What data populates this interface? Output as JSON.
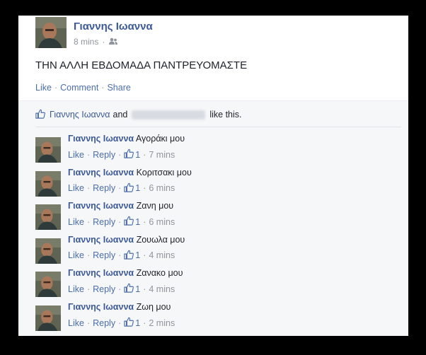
{
  "post": {
    "author": "Γιαννης Ιωαννα",
    "time": "8 mins",
    "separator": "·",
    "text": "ΤΗΝ ΑΛΛΗ ΕΒΔΟΜΑΔΑ ΠΑΝΤΡΕΥΟΜΑΣΤΕ",
    "actions": {
      "like": "Like",
      "comment": "Comment",
      "share": "Share"
    }
  },
  "likes": {
    "name": "Γιαννης Ιωαννα",
    "and": "and",
    "suffix": "like this."
  },
  "comments": [
    {
      "author": "Γιαννης Ιωαννα",
      "text": "Αγοράκι μου",
      "like": "Like",
      "reply": "Reply",
      "count": "1",
      "time": "7 mins"
    },
    {
      "author": "Γιαννης Ιωαννα",
      "text": "Κοριτσακι μου",
      "like": "Like",
      "reply": "Reply",
      "count": "1",
      "time": "6 mins"
    },
    {
      "author": "Γιαννης Ιωαννα",
      "text": "Ζανη μου",
      "like": "Like",
      "reply": "Reply",
      "count": "1",
      "time": "6 mins"
    },
    {
      "author": "Γιαννης Ιωαννα",
      "text": "Ζουωλα μου",
      "like": "Like",
      "reply": "Reply",
      "count": "1",
      "time": "4 mins"
    },
    {
      "author": "Γιαννης Ιωαννα",
      "text": "Ζανακο μου",
      "like": "Like",
      "reply": "Reply",
      "count": "1",
      "time": "4 mins"
    },
    {
      "author": "Γιαννης Ιωαννα",
      "text": "Ζωη μου",
      "like": "Like",
      "reply": "Reply",
      "count": "1",
      "time": "2 mins"
    }
  ],
  "colors": {
    "link": "#3b5998",
    "muted": "#90949c",
    "background": "#000000"
  },
  "icons": {
    "audience": "friends-icon",
    "like": "thumbs-up-icon"
  }
}
